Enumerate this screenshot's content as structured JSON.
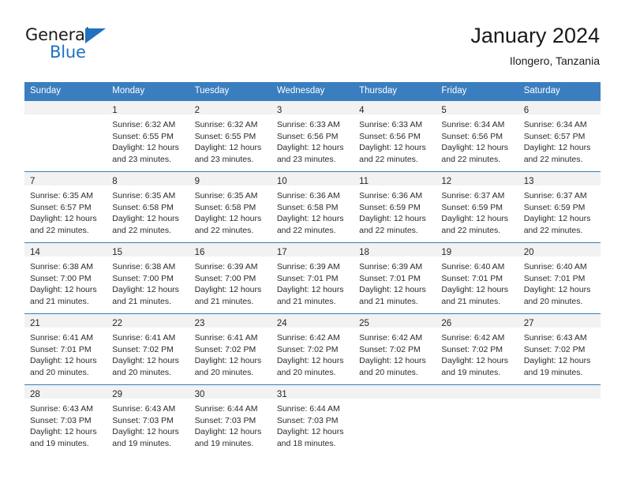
{
  "brand": {
    "name_part1": "General",
    "name_part2": "Blue",
    "accent_color": "#1f72bd"
  },
  "header": {
    "title": "January 2024",
    "subtitle": "Ilongero, Tanzania"
  },
  "calendar": {
    "header_color": "#3a7ebf",
    "daynum_band_color": "#f2f2f2",
    "day_names": [
      "Sunday",
      "Monday",
      "Tuesday",
      "Wednesday",
      "Thursday",
      "Friday",
      "Saturday"
    ],
    "weeks": [
      [
        {
          "day": "",
          "lines": []
        },
        {
          "day": "1",
          "lines": [
            "Sunrise: 6:32 AM",
            "Sunset: 6:55 PM",
            "Daylight: 12 hours",
            "and 23 minutes."
          ]
        },
        {
          "day": "2",
          "lines": [
            "Sunrise: 6:32 AM",
            "Sunset: 6:55 PM",
            "Daylight: 12 hours",
            "and 23 minutes."
          ]
        },
        {
          "day": "3",
          "lines": [
            "Sunrise: 6:33 AM",
            "Sunset: 6:56 PM",
            "Daylight: 12 hours",
            "and 23 minutes."
          ]
        },
        {
          "day": "4",
          "lines": [
            "Sunrise: 6:33 AM",
            "Sunset: 6:56 PM",
            "Daylight: 12 hours",
            "and 22 minutes."
          ]
        },
        {
          "day": "5",
          "lines": [
            "Sunrise: 6:34 AM",
            "Sunset: 6:56 PM",
            "Daylight: 12 hours",
            "and 22 minutes."
          ]
        },
        {
          "day": "6",
          "lines": [
            "Sunrise: 6:34 AM",
            "Sunset: 6:57 PM",
            "Daylight: 12 hours",
            "and 22 minutes."
          ]
        }
      ],
      [
        {
          "day": "7",
          "lines": [
            "Sunrise: 6:35 AM",
            "Sunset: 6:57 PM",
            "Daylight: 12 hours",
            "and 22 minutes."
          ]
        },
        {
          "day": "8",
          "lines": [
            "Sunrise: 6:35 AM",
            "Sunset: 6:58 PM",
            "Daylight: 12 hours",
            "and 22 minutes."
          ]
        },
        {
          "day": "9",
          "lines": [
            "Sunrise: 6:35 AM",
            "Sunset: 6:58 PM",
            "Daylight: 12 hours",
            "and 22 minutes."
          ]
        },
        {
          "day": "10",
          "lines": [
            "Sunrise: 6:36 AM",
            "Sunset: 6:58 PM",
            "Daylight: 12 hours",
            "and 22 minutes."
          ]
        },
        {
          "day": "11",
          "lines": [
            "Sunrise: 6:36 AM",
            "Sunset: 6:59 PM",
            "Daylight: 12 hours",
            "and 22 minutes."
          ]
        },
        {
          "day": "12",
          "lines": [
            "Sunrise: 6:37 AM",
            "Sunset: 6:59 PM",
            "Daylight: 12 hours",
            "and 22 minutes."
          ]
        },
        {
          "day": "13",
          "lines": [
            "Sunrise: 6:37 AM",
            "Sunset: 6:59 PM",
            "Daylight: 12 hours",
            "and 22 minutes."
          ]
        }
      ],
      [
        {
          "day": "14",
          "lines": [
            "Sunrise: 6:38 AM",
            "Sunset: 7:00 PM",
            "Daylight: 12 hours",
            "and 21 minutes."
          ]
        },
        {
          "day": "15",
          "lines": [
            "Sunrise: 6:38 AM",
            "Sunset: 7:00 PM",
            "Daylight: 12 hours",
            "and 21 minutes."
          ]
        },
        {
          "day": "16",
          "lines": [
            "Sunrise: 6:39 AM",
            "Sunset: 7:00 PM",
            "Daylight: 12 hours",
            "and 21 minutes."
          ]
        },
        {
          "day": "17",
          "lines": [
            "Sunrise: 6:39 AM",
            "Sunset: 7:01 PM",
            "Daylight: 12 hours",
            "and 21 minutes."
          ]
        },
        {
          "day": "18",
          "lines": [
            "Sunrise: 6:39 AM",
            "Sunset: 7:01 PM",
            "Daylight: 12 hours",
            "and 21 minutes."
          ]
        },
        {
          "day": "19",
          "lines": [
            "Sunrise: 6:40 AM",
            "Sunset: 7:01 PM",
            "Daylight: 12 hours",
            "and 21 minutes."
          ]
        },
        {
          "day": "20",
          "lines": [
            "Sunrise: 6:40 AM",
            "Sunset: 7:01 PM",
            "Daylight: 12 hours",
            "and 20 minutes."
          ]
        }
      ],
      [
        {
          "day": "21",
          "lines": [
            "Sunrise: 6:41 AM",
            "Sunset: 7:01 PM",
            "Daylight: 12 hours",
            "and 20 minutes."
          ]
        },
        {
          "day": "22",
          "lines": [
            "Sunrise: 6:41 AM",
            "Sunset: 7:02 PM",
            "Daylight: 12 hours",
            "and 20 minutes."
          ]
        },
        {
          "day": "23",
          "lines": [
            "Sunrise: 6:41 AM",
            "Sunset: 7:02 PM",
            "Daylight: 12 hours",
            "and 20 minutes."
          ]
        },
        {
          "day": "24",
          "lines": [
            "Sunrise: 6:42 AM",
            "Sunset: 7:02 PM",
            "Daylight: 12 hours",
            "and 20 minutes."
          ]
        },
        {
          "day": "25",
          "lines": [
            "Sunrise: 6:42 AM",
            "Sunset: 7:02 PM",
            "Daylight: 12 hours",
            "and 20 minutes."
          ]
        },
        {
          "day": "26",
          "lines": [
            "Sunrise: 6:42 AM",
            "Sunset: 7:02 PM",
            "Daylight: 12 hours",
            "and 19 minutes."
          ]
        },
        {
          "day": "27",
          "lines": [
            "Sunrise: 6:43 AM",
            "Sunset: 7:02 PM",
            "Daylight: 12 hours",
            "and 19 minutes."
          ]
        }
      ],
      [
        {
          "day": "28",
          "lines": [
            "Sunrise: 6:43 AM",
            "Sunset: 7:03 PM",
            "Daylight: 12 hours",
            "and 19 minutes."
          ]
        },
        {
          "day": "29",
          "lines": [
            "Sunrise: 6:43 AM",
            "Sunset: 7:03 PM",
            "Daylight: 12 hours",
            "and 19 minutes."
          ]
        },
        {
          "day": "30",
          "lines": [
            "Sunrise: 6:44 AM",
            "Sunset: 7:03 PM",
            "Daylight: 12 hours",
            "and 19 minutes."
          ]
        },
        {
          "day": "31",
          "lines": [
            "Sunrise: 6:44 AM",
            "Sunset: 7:03 PM",
            "Daylight: 12 hours",
            "and 18 minutes."
          ]
        },
        {
          "day": "",
          "lines": []
        },
        {
          "day": "",
          "lines": []
        },
        {
          "day": "",
          "lines": []
        }
      ]
    ]
  }
}
